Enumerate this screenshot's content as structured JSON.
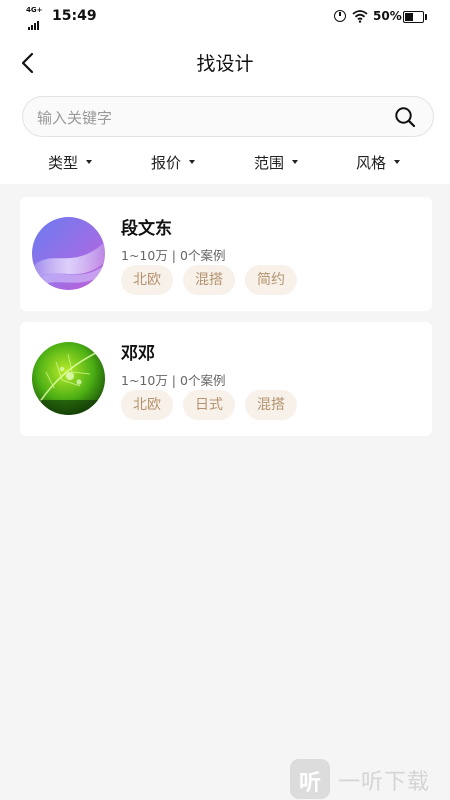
{
  "status_bar": {
    "network": "4G+",
    "time": "15:49",
    "battery_percent": "50%",
    "battery_level": 0.5
  },
  "header": {
    "title": "找设计",
    "back_icon": "chevron-left-icon"
  },
  "search": {
    "placeholder": "输入关键字",
    "value": "",
    "icon": "search-icon"
  },
  "filters": [
    {
      "label": "类型"
    },
    {
      "label": "报价"
    },
    {
      "label": "范围"
    },
    {
      "label": "风格"
    }
  ],
  "designers": [
    {
      "name": "段文东",
      "meta": "1~10万 | 0个案例",
      "tags": [
        "北欧",
        "混搭",
        "简约"
      ],
      "avatar": "purple-abstract-avatar"
    },
    {
      "name": "邓邓",
      "meta": "1~10万 | 0个案例",
      "tags": [
        "北欧",
        "日式",
        "混搭"
      ],
      "avatar": "green-leaf-avatar"
    }
  ],
  "watermark": {
    "glyph": "听",
    "text": "一听下载"
  },
  "colors": {
    "background": "#f5f5f5",
    "card": "#ffffff",
    "tag_bg": "#f7f1ea",
    "tag_text": "#b49470"
  }
}
